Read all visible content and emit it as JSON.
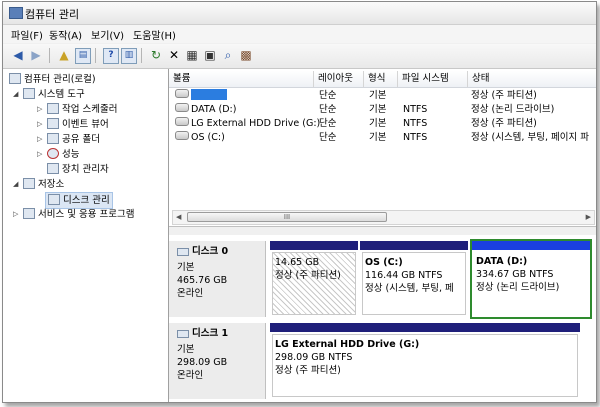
{
  "window": {
    "title": "컴퓨터 관리"
  },
  "menu": [
    "파일(F)",
    "동작(A)",
    "보기(V)",
    "도움말(H)"
  ],
  "toolbar": {
    "icons": [
      "back-arrow-icon",
      "forward-arrow-icon",
      "folder-up-icon",
      "console-tree-icon",
      "help-icon",
      "properties-icon",
      "refresh-icon",
      "delete-icon",
      "open-icon",
      "new-icon",
      "find-icon",
      "extra-icon"
    ]
  },
  "tree": {
    "root": "컴퓨터 관리(로컬)",
    "system_tools": "시스템 도구",
    "task_scheduler": "작업 스케줄러",
    "event_viewer": "이벤트 뷰어",
    "shared_folders": "공유 폴더",
    "performance": "성능",
    "device_manager": "장치 관리자",
    "storage": "저장소",
    "disk_management": "디스크 관리",
    "services_apps": "서비스 및 응용 프로그램"
  },
  "volumes": {
    "columns": [
      "볼륨",
      "레이아웃",
      "형식",
      "파일 시스템",
      "상태"
    ],
    "rows": [
      {
        "name": "",
        "layout": "단순",
        "type": "기본",
        "fs": "",
        "status": "정상 (주 파티션)"
      },
      {
        "name": "DATA (D:)",
        "layout": "단순",
        "type": "기본",
        "fs": "NTFS",
        "status": "정상 (논리 드라이브)"
      },
      {
        "name": "LG External HDD Drive (G:)",
        "layout": "단순",
        "type": "기본",
        "fs": "NTFS",
        "status": "정상 (주 파티션)"
      },
      {
        "name": "OS (C:)",
        "layout": "단순",
        "type": "기본",
        "fs": "NTFS",
        "status": "정상 (시스템, 부팅, 페이지 파"
      }
    ],
    "scroll_thumb_glyph": "III"
  },
  "disks": [
    {
      "name": "디스크 0",
      "kind": "기본",
      "size": "465.76 GB",
      "status": "온라인",
      "partitions": [
        {
          "title": "",
          "size": "14.65 GB",
          "status": "정상 (주 파티션)"
        },
        {
          "title": "OS  (C:)",
          "size": "116.44 GB NTFS",
          "status": "정상 (시스템, 부팅, 페"
        },
        {
          "title": "DATA  (D:)",
          "size": "334.67 GB NTFS",
          "status": "정상 (논리 드라이브)"
        }
      ]
    },
    {
      "name": "디스크 1",
      "kind": "기본",
      "size": "298.09 GB",
      "status": "온라인",
      "partitions": [
        {
          "title": "LG External HDD Drive  (G:)",
          "size": "298.09 GB NTFS",
          "status": "정상 (주 파티션)"
        }
      ]
    }
  ],
  "colors": {
    "primary_bar": "#1f1f7a",
    "logical_bar": "#1a3fe0",
    "selection": "#2e8b2e"
  }
}
